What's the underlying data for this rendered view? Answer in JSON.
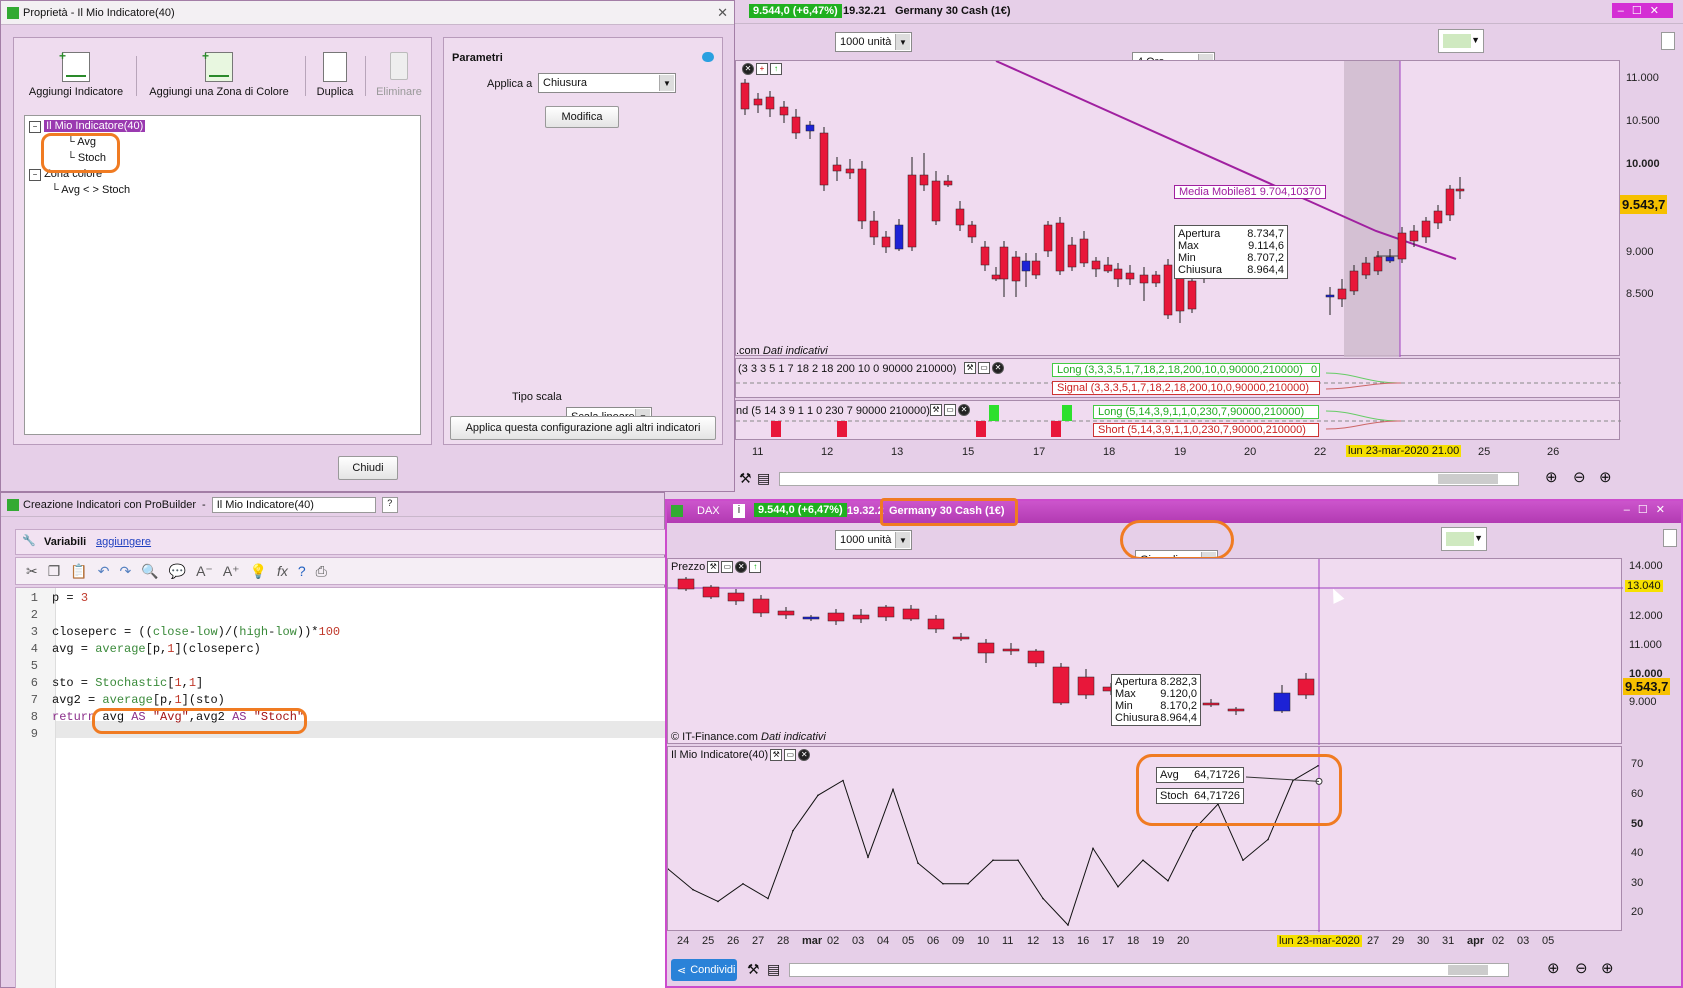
{
  "props_window": {
    "title": "Proprietà - Il Mio Indicatore(40)",
    "toolbar": {
      "add_indicator": "Aggiungi Indicatore",
      "add_zone": "Aggiungi una Zona di Colore",
      "duplicate": "Duplica",
      "delete": "Eliminare"
    },
    "tree": {
      "root": "Il Mio Indicatore(40)",
      "children": [
        "Avg",
        "Stoch"
      ],
      "zone_root": "Zona colore",
      "zone_child": "Avg < > Stoch"
    },
    "params": {
      "title": "Parametri",
      "apply_to_label": "Applica a",
      "apply_to_value": "Chiusura",
      "modify": "Modifica",
      "scale_label": "Tipo scala",
      "scale_value": "Scala lineare",
      "apply_all": "Applica questa configurazione agli altri indicatori"
    },
    "close": "Chiudi"
  },
  "top_chart": {
    "price_header": "9.544,0 (+6,47%)",
    "time": "19.32.21",
    "instrument": "Germany 30 Cash (1€)",
    "units": "1000 unità",
    "timeframe": "4 Ore",
    "source_label": ".com",
    "source_note": "Dati indicativi",
    "price_ticks": [
      "11.000",
      "10.500",
      "10.000",
      "9.000",
      "8.500"
    ],
    "last_price": "9.543,7",
    "ma_label": "Media Mobile81  9.704,10370",
    "tooltip": [
      [
        "Apertura",
        "8.734,7"
      ],
      [
        "Max",
        "9.114,6"
      ],
      [
        "Min",
        "8.707,2"
      ],
      [
        "Chiusura",
        "8.964,4"
      ]
    ],
    "ind1_label": "(3 3 3 5 1 7 18 2 18 200 10 0 90000 210000)",
    "ind1_long": "Long (3,3,3,5,1,7,18,2,18,200,10,0,90000,210000)",
    "ind1_signal": "Signal (3,3,3,5,1,7,18,2,18,200,10,0,90000,210000)",
    "ind1_zero": "0",
    "ind2_label": "nd (5 14 3 9 1 1 0 230 7 90000 210000)",
    "ind2_long": "Long (5,14,3,9,1,1,0,230,7,90000,210000)",
    "ind2_short": "Short (5,14,3,9,1,1,0,230,7,90000,210000)",
    "x_ticks": [
      "11",
      "12",
      "13",
      "15",
      "17",
      "18",
      "19",
      "20",
      "22",
      "25",
      "26"
    ],
    "x_highlight": "lun 23-mar-2020 21.00"
  },
  "builder": {
    "title": "Creazione Indicatori con ProBuilder",
    "name_value": "Il Mio Indicatore(40)",
    "vars_label": "Variabili",
    "vars_link": "aggiungere",
    "code_lines": [
      "p = 3",
      "",
      "closeperc = ((close-low)/(high-low))*100",
      "avg = average[p,1](closeperc)",
      "",
      "sto = Stochastic[1,1]",
      "avg2 = average[p,1](sto)",
      "return avg AS \"Avg\",avg2 AS \"Stoch\"",
      ""
    ]
  },
  "bottom_chart": {
    "symbol": "DAX",
    "price_header": "9.544,0 (+6,47%)",
    "time": "19.32.2",
    "instrument": "Germany 30 Cash (1€)",
    "units": "1000 unità",
    "timeframe": "Giornaliero",
    "price_panel_label": "Prezzo",
    "source_label": "© IT-Finance.com",
    "source_note": "Dati indicativi",
    "price_ticks": [
      "14.000",
      "13.040",
      "12.000",
      "11.000",
      "10.000",
      "9.000"
    ],
    "last_price": "9.543,7",
    "tooltip": [
      [
        "Apertura",
        "8.282,3"
      ],
      [
        "Max",
        "9.120,0"
      ],
      [
        "Min",
        "8.170,2"
      ],
      [
        "Chiusura",
        "8.964,4"
      ]
    ],
    "ind_label": "Il Mio Indicatore(40)",
    "ind_ticks": [
      "70",
      "60",
      "50",
      "40",
      "30",
      "20"
    ],
    "ind_tooltip": [
      [
        "Avg",
        "64,71726"
      ],
      [
        "Stoch",
        "64,71726"
      ]
    ],
    "x_ticks": [
      "24",
      "25",
      "26",
      "27",
      "28",
      "mar",
      "02",
      "03",
      "04",
      "05",
      "06",
      "09",
      "10",
      "11",
      "12",
      "13",
      "16",
      "17",
      "18",
      "19",
      "20",
      "25",
      "26",
      "27",
      "29",
      "30",
      "31",
      "apr",
      "02",
      "03",
      "05"
    ],
    "x_highlight": "lun 23-mar-2020",
    "share": "Condividi"
  },
  "chart_data": {
    "type": "line",
    "series": [
      {
        "name": "Il Mio Indicatore(40)",
        "values": [
          35,
          28,
          24,
          30,
          25,
          48,
          60,
          65,
          39,
          62,
          37,
          30,
          30,
          38,
          38,
          25,
          16,
          42,
          29,
          38,
          31,
          48,
          57,
          38,
          45,
          65,
          70
        ]
      }
    ],
    "ylim": [
      15,
      75
    ]
  },
  "colors": {
    "bear": "#e8173a",
    "bull": "#1c22d6",
    "ma": "#a020a0",
    "highlight": "#f07b22"
  }
}
